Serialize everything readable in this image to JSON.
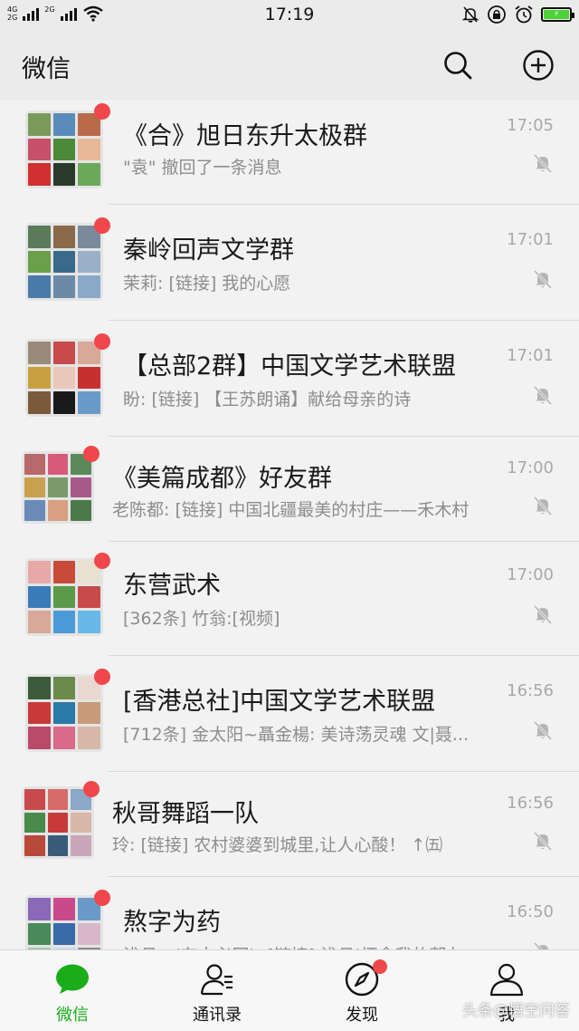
{
  "status_bar": {
    "network_top": "4G",
    "network_bottom": "2G",
    "network2_top": "2G",
    "time": "17:19",
    "battery_color": "#4cd137"
  },
  "header": {
    "title": "微信",
    "search_icon": "search-icon",
    "add_icon": "plus-circle-icon"
  },
  "chats": [
    {
      "name": "《合》旭日东升太极群",
      "message": "\"袁\" 撤回了一条消息",
      "time": "17:05",
      "unread": true,
      "muted": true
    },
    {
      "name": "秦岭回声文学群",
      "message": "茉莉: [链接] 我的心愿",
      "time": "17:01",
      "unread": true,
      "muted": true
    },
    {
      "name": "【总部2群】中国文学艺术联盟",
      "message": "盼: [链接] 【王苏朗诵】献给母亲的诗",
      "time": "17:01",
      "unread": true,
      "muted": true
    },
    {
      "name": "《美篇成都》好友群",
      "message": "老陈都: [链接] 中国北疆最美的村庄——禾木村",
      "time": "17:00",
      "unread": true,
      "muted": true
    },
    {
      "name": "东营武术",
      "message": "[362条] 竹翁:[视频]",
      "time": "17:00",
      "unread": true,
      "muted": true
    },
    {
      "name": "[香港总社]中国文学艺术联盟",
      "message": "[712条] 金太阳~聶金楊: 美诗荡灵魂 文|聂...",
      "time": "16:56",
      "unread": true,
      "muted": true
    },
    {
      "name": "秋哥舞蹈一队",
      "message": "玲: [链接] 农村婆婆到城里,让人心酸！ ↑㈤",
      "time": "16:56",
      "unread": true,
      "muted": true
    },
    {
      "name": "熬字为药",
      "message": "浅月...(东去必回): [链接] 浅月|怀念我的帮友",
      "time": "16:50",
      "unread": true,
      "muted": true
    }
  ],
  "tabs": [
    {
      "label": "微信",
      "icon": "chat-bubble-icon",
      "active": true
    },
    {
      "label": "通讯录",
      "icon": "contacts-icon",
      "active": false
    },
    {
      "label": "发现",
      "icon": "compass-icon",
      "active": false
    },
    {
      "label": "我",
      "icon": "person-icon",
      "active": false
    }
  ],
  "watermark": "头条@悟空问答",
  "colors": {
    "accent_green": "#1aad19",
    "badge_red": "#f0484a",
    "muted_gray": "#8d8d8d"
  }
}
